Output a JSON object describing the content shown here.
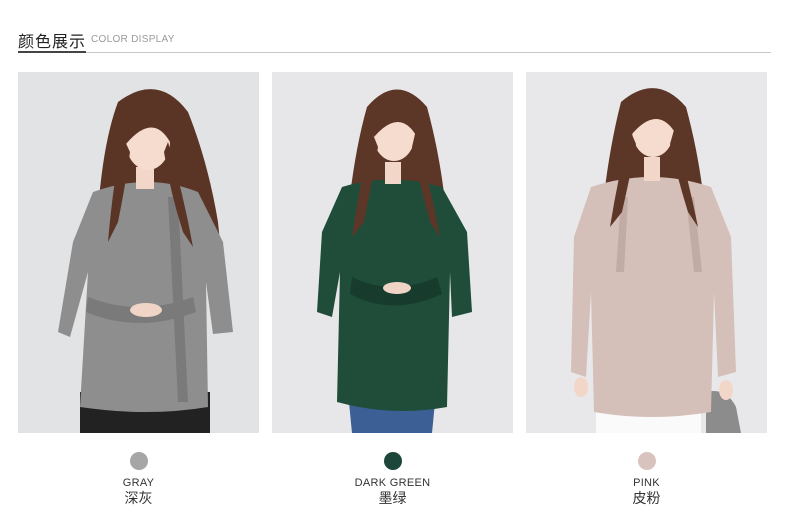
{
  "header": {
    "title_cn": "颜色展示",
    "title_en": "COLOR DISPLAY"
  },
  "colors": [
    {
      "name_en": "GRAY",
      "name_cn": "深灰",
      "swatch_color": "#a6a6a6",
      "garment_color": "#8e8e8e",
      "garment_shade": "#7a7a7a"
    },
    {
      "name_en": "DARK GREEN",
      "name_cn": "墨绿",
      "swatch_color": "#1d463a",
      "garment_color": "#1f4d3a",
      "garment_shade": "#173c2d"
    },
    {
      "name_en": "PINK",
      "name_cn": "皮粉",
      "swatch_color": "#d9c3be",
      "garment_color": "#d5bfb9",
      "garment_shade": "#c3aba5"
    }
  ]
}
